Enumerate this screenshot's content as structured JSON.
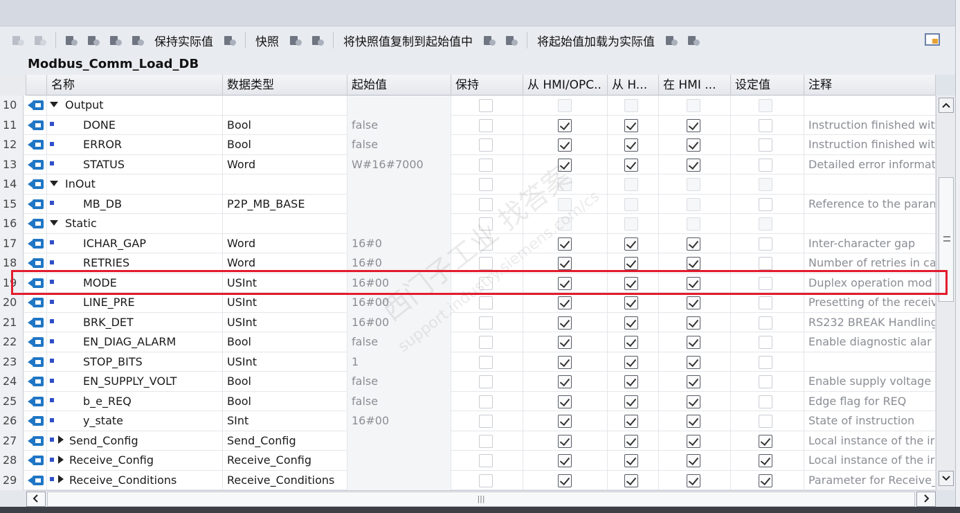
{
  "toolbar": {
    "keep_actual": "保持实际值",
    "snapshot": "快照",
    "copy_snapshot": "将快照值复制到起始值中",
    "load_start": "将起始值加载为实际值"
  },
  "db_title": "Modbus_Comm_Load_DB",
  "columns": {
    "name": "名称",
    "dtype": "数据类型",
    "start": "起始值",
    "retain": "保持",
    "hmi1": "从 HMI/OPC..",
    "hmi2": "从 H...",
    "hmi3": "在 HMI ...",
    "setpoint": "设定值",
    "comment": "注释"
  },
  "rows": [
    {
      "num": "10",
      "kind": "group",
      "name": "Output",
      "dtype": "",
      "start": "",
      "retain": "off",
      "h1": "dis",
      "h2": "dis",
      "h3": "dis",
      "set": "dis",
      "comment": ""
    },
    {
      "num": "11",
      "kind": "leaf",
      "name": "DONE",
      "dtype": "Bool",
      "start": "false",
      "retain": "off",
      "h1": "on",
      "h2": "on",
      "h3": "on",
      "set": "off",
      "comment": "Instruction finished wit"
    },
    {
      "num": "12",
      "kind": "leaf",
      "name": "ERROR",
      "dtype": "Bool",
      "start": "false",
      "retain": "off",
      "h1": "on",
      "h2": "on",
      "h3": "on",
      "set": "off",
      "comment": "Instruction finished wit"
    },
    {
      "num": "13",
      "kind": "leaf",
      "name": "STATUS",
      "dtype": "Word",
      "start": "W#16#7000",
      "retain": "off",
      "h1": "on",
      "h2": "on",
      "h3": "on",
      "set": "off",
      "comment": "Detailed error informat"
    },
    {
      "num": "14",
      "kind": "group",
      "name": "InOut",
      "dtype": "",
      "start": "",
      "retain": "off",
      "h1": "dis",
      "h2": "dis",
      "h3": "dis",
      "set": "dis",
      "comment": ""
    },
    {
      "num": "15",
      "kind": "leaf",
      "name": "MB_DB",
      "dtype": "P2P_MB_BASE",
      "start": "",
      "retain": "off",
      "h1": "dis",
      "h2": "dis",
      "h3": "dis",
      "set": "off",
      "comment": "Reference to the paran"
    },
    {
      "num": "16",
      "kind": "group",
      "name": "Static",
      "dtype": "",
      "start": "",
      "retain": "off",
      "h1": "dis",
      "h2": "dis",
      "h3": "dis",
      "set": "dis",
      "comment": ""
    },
    {
      "num": "17",
      "kind": "leaf",
      "name": "ICHAR_GAP",
      "dtype": "Word",
      "start": "16#0",
      "retain": "off",
      "h1": "on",
      "h2": "on",
      "h3": "on",
      "set": "off",
      "comment": "Inter-character gap"
    },
    {
      "num": "18",
      "kind": "leaf",
      "name": "RETRIES",
      "dtype": "Word",
      "start": "16#0",
      "retain": "off",
      "h1": "on",
      "h2": "on",
      "h3": "on",
      "set": "off",
      "comment": "Number of retries in ca"
    },
    {
      "num": "19",
      "kind": "leaf",
      "name": "MODE",
      "dtype": "USInt",
      "start": "16#00",
      "retain": "off",
      "h1": "on",
      "h2": "on",
      "h3": "on",
      "set": "off",
      "comment": "Duplex operation mod"
    },
    {
      "num": "20",
      "kind": "leaf",
      "name": "LINE_PRE",
      "dtype": "USInt",
      "start": "16#00",
      "retain": "off",
      "h1": "on",
      "h2": "on",
      "h3": "on",
      "set": "off",
      "comment": "Presetting of the receiv"
    },
    {
      "num": "21",
      "kind": "leaf",
      "name": "BRK_DET",
      "dtype": "USInt",
      "start": "16#00",
      "retain": "off",
      "h1": "on",
      "h2": "on",
      "h3": "on",
      "set": "off",
      "comment": "RS232 BREAK Handling"
    },
    {
      "num": "22",
      "kind": "leaf",
      "name": "EN_DIAG_ALARM",
      "dtype": "Bool",
      "start": "false",
      "retain": "off",
      "h1": "on",
      "h2": "on",
      "h3": "on",
      "set": "off",
      "comment": "Enable diagnostic alar"
    },
    {
      "num": "23",
      "kind": "leaf",
      "name": "STOP_BITS",
      "dtype": "USInt",
      "start": "1",
      "retain": "off",
      "h1": "on",
      "h2": "on",
      "h3": "on",
      "set": "off",
      "comment": ""
    },
    {
      "num": "24",
      "kind": "leaf",
      "name": "EN_SUPPLY_VOLT",
      "dtype": "Bool",
      "start": "false",
      "retain": "off",
      "h1": "on",
      "h2": "on",
      "h3": "on",
      "set": "off",
      "comment": "Enable supply voltage"
    },
    {
      "num": "25",
      "kind": "leaf",
      "name": "b_e_REQ",
      "dtype": "Bool",
      "start": "false",
      "retain": "off",
      "h1": "on",
      "h2": "on",
      "h3": "on",
      "set": "off",
      "comment": "Edge flag for REQ"
    },
    {
      "num": "26",
      "kind": "leaf",
      "name": "y_state",
      "dtype": "SInt",
      "start": "16#00",
      "retain": "off",
      "h1": "on",
      "h2": "on",
      "h3": "on",
      "set": "off",
      "comment": "State of instruction"
    },
    {
      "num": "27",
      "kind": "struct",
      "name": "Send_Config",
      "dtype": "Send_Config",
      "start": "",
      "retain": "off",
      "h1": "on",
      "h2": "on",
      "h3": "on",
      "set": "on",
      "comment": "Local instance of the ir"
    },
    {
      "num": "28",
      "kind": "struct",
      "name": "Receive_Config",
      "dtype": "Receive_Config",
      "start": "",
      "retain": "off",
      "h1": "on",
      "h2": "on",
      "h3": "on",
      "set": "on",
      "comment": "Local instance of the ir"
    },
    {
      "num": "29",
      "kind": "struct",
      "name": "Receive_Conditions",
      "dtype": "Receive_Conditions",
      "start": "",
      "retain": "off",
      "h1": "on",
      "h2": "on",
      "h3": "on",
      "set": "on",
      "comment": "Parameter for Receive_"
    }
  ],
  "watermark": {
    "line1": "西门子工业 找答案",
    "line2": "support.industry.siemens.com/cs"
  },
  "highlight_color": "#e21b2c",
  "icons": [
    "toolbar-icon",
    "interface-icon",
    "expand-arrow-icon",
    "collapse-arrow-icon",
    "scroll-up-icon",
    "scroll-down-icon",
    "scroll-left-icon",
    "scroll-right-icon",
    "window-layout-icon"
  ]
}
